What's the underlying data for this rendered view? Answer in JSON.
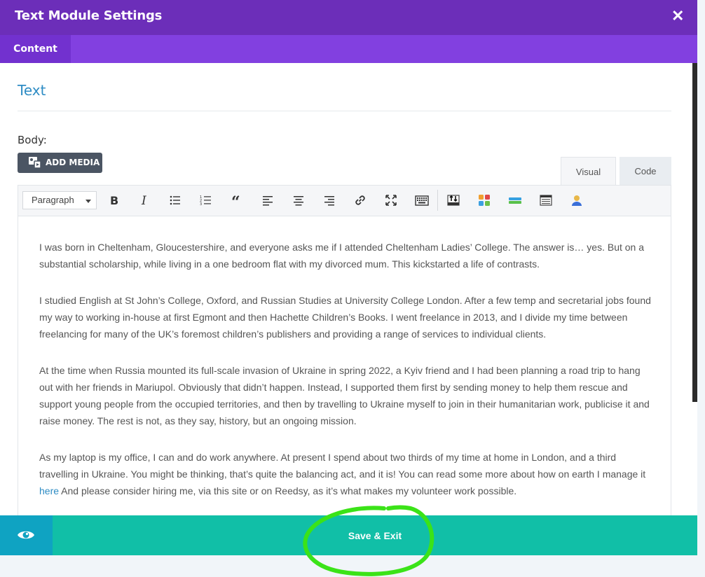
{
  "modal": {
    "title": "Text Module Settings",
    "tabs": [
      {
        "label": "Content"
      }
    ]
  },
  "section": {
    "title": "Text"
  },
  "body": {
    "label": "Body:",
    "add_media_label": "ADD MEDIA"
  },
  "editor": {
    "modes": [
      {
        "label": "Visual",
        "active": true
      },
      {
        "label": "Code",
        "active": false
      }
    ],
    "format_select": "Paragraph",
    "toolbar_icons": [
      "bold-icon",
      "italic-icon",
      "bullet-list-icon",
      "numbered-list-icon",
      "blockquote-icon",
      "align-left-icon",
      "align-center-icon",
      "align-right-icon",
      "link-icon",
      "fullscreen-icon",
      "keyboard-icon",
      "insert-toggle-icon",
      "color-grid-icon",
      "divider-icon",
      "table-icon",
      "person-icon"
    ],
    "paragraphs": [
      "I was born in Cheltenham, Gloucestershire, and everyone asks me if I attended Cheltenham Ladies’ College. The answer is… yes. But on a substantial scholarship, while living in a one bedroom flat with my divorced mum. This kickstarted a life of contrasts.",
      "I studied English at St John’s College, Oxford, and Russian Studies at University College London. After a few temp and secretarial jobs found my way to working in-house at first Egmont and then Hachette Children’s Books. I went freelance in 2013, and I divide my time between freelancing for many of the UK’s foremost children’s publishers and providing a range of services to individual clients.",
      "At the time when Russia mounted its full-scale invasion of Ukraine in spring 2022, a Kyiv friend and I had been planning a road trip to hang out with her friends in Mariupol. Obviously that didn’t happen. Instead, I supported them first by sending money to help them rescue and support young people from the occupied territories, and then by travelling to Ukraine myself to join in their humanitarian work, publicise it and raise money. The rest is not, as they say, history, but an ongoing mission."
    ],
    "last_paragraph": {
      "before_link": "As my laptop is my office, I can and do work anywhere. At present I spend about two thirds of my time at home in London, and a third travelling in Ukraine. You might be thinking, that’s quite the balancing act, and it is! You can read some more about how on earth I manage it ",
      "link_text": "here",
      "after_link": " And please consider hiring me, via this site or on Reedsy, as it’s what makes my volunteer work possible."
    }
  },
  "footer": {
    "save_label": "Save & Exit"
  },
  "colors": {
    "header": "#6c2eb9",
    "tabbar": "#8240e0",
    "accent_blue": "#2e8cc4",
    "footer": "#11bfa7",
    "preview": "#0fa3c2",
    "annotation": "#3be318"
  }
}
